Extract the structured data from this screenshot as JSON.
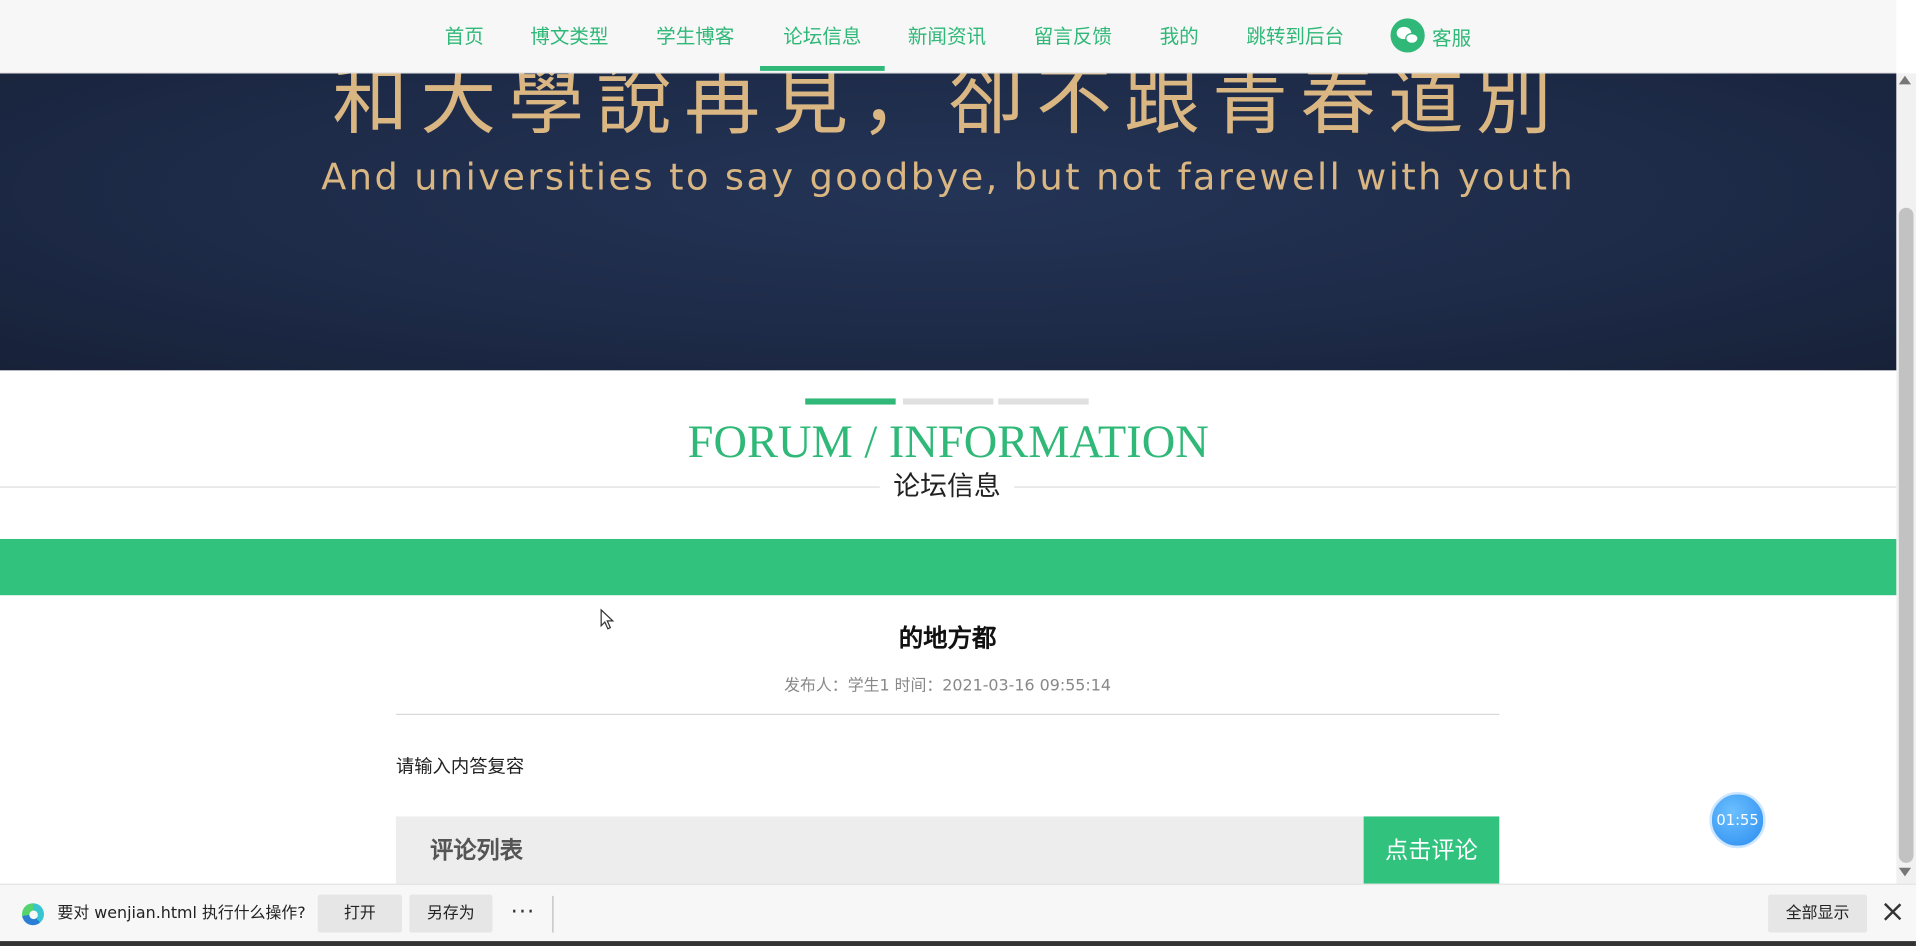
{
  "nav": {
    "items": [
      {
        "label": "首页"
      },
      {
        "label": "博文类型"
      },
      {
        "label": "学生博客"
      },
      {
        "label": "论坛信息"
      },
      {
        "label": "新闻资讯"
      },
      {
        "label": "留言反馈"
      },
      {
        "label": "我的"
      },
      {
        "label": "跳转到后台"
      }
    ],
    "active_index": 3,
    "service_label": "客服",
    "accent_color": "#2fb877"
  },
  "banner": {
    "text_cn": "和大學說再見，卻不跟青春道別",
    "text_en": "And universities to say goodbye, but not farewell with youth"
  },
  "section": {
    "title_en": "FORUM / INFORMATION",
    "title_cn": "论坛信息"
  },
  "article": {
    "title": "的地方都",
    "meta": "发布人：学生1 时间：2021-03-16 09:55:14",
    "content": "请输入内答复容"
  },
  "comments": {
    "title": "评论列表",
    "button_label": "点击评论"
  },
  "timer": {
    "label": "01:55"
  },
  "download_bar": {
    "prompt": "要对 wenjian.html 执行什么操作?",
    "open_label": "打开",
    "saveas_label": "另存为",
    "more_label": "···",
    "show_all_label": "全部显示"
  }
}
